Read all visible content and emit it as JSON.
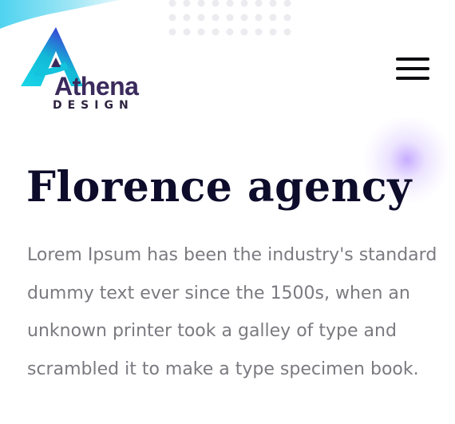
{
  "brand": {
    "name": "Athena",
    "tagline": "DESIGN",
    "logo_icon": "triangle-a-logo-icon",
    "colors": {
      "gradient_start": "#19d6e8",
      "gradient_end": "#3b3fd6",
      "wordmark": "#3b2a5c"
    }
  },
  "header": {
    "menu_icon": "hamburger-menu-icon"
  },
  "hero": {
    "title": "Florence agency",
    "description": "Lorem Ipsum has been the industry's standard dummy text ever since the 1500s, when an unknown printer took a galley of type and scrambled it to make a type specimen book."
  },
  "decor": {
    "dot_grid_icon": "dot-grid-icon",
    "wave_icon": "wave-shape-icon",
    "glow_color": "#c4a8ff"
  }
}
